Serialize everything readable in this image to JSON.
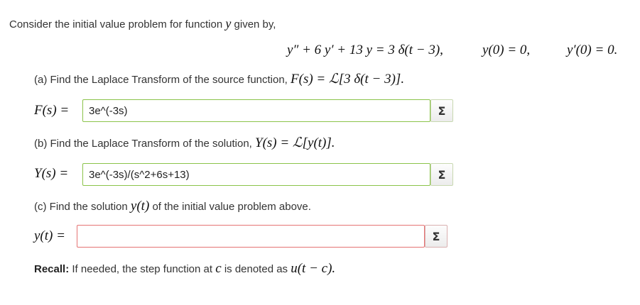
{
  "intro": "Consider the initial value problem for function",
  "intro_var": "y",
  "intro_tail": "given by,",
  "equation": {
    "lhs": "y″ + 6 y′ + 13 y = 3 δ(t − 3),",
    "ic1": "y(0) = 0,",
    "ic2": "y′(0) = 0."
  },
  "part_a": {
    "prompt": "(a) Find the Laplace Transform of the source function,",
    "math": "F(s) = ℒ[3 δ(t − 3)].",
    "label": "F(s) =",
    "value": "3e^(-3s)"
  },
  "part_b": {
    "prompt": "(b) Find the Laplace Transform of the solution,",
    "math": "Y(s) = ℒ[y(t)].",
    "label": "Y(s) =",
    "value": "3e^(-3s)/(s^2+6s+13)"
  },
  "part_c": {
    "prompt_pre": "(c) Find the solution",
    "prompt_math": "y(t)",
    "prompt_post": "of the initial value problem above.",
    "label": "y(t) =",
    "value": ""
  },
  "recall": {
    "bold": "Recall:",
    "text": "If needed, the step function at",
    "var": "c",
    "text2": "is denoted as",
    "math": "u(t − c)."
  },
  "sigma_symbol": "Σ",
  "colors": {
    "valid_border": "#8bc34a",
    "invalid_border": "#e57373"
  }
}
